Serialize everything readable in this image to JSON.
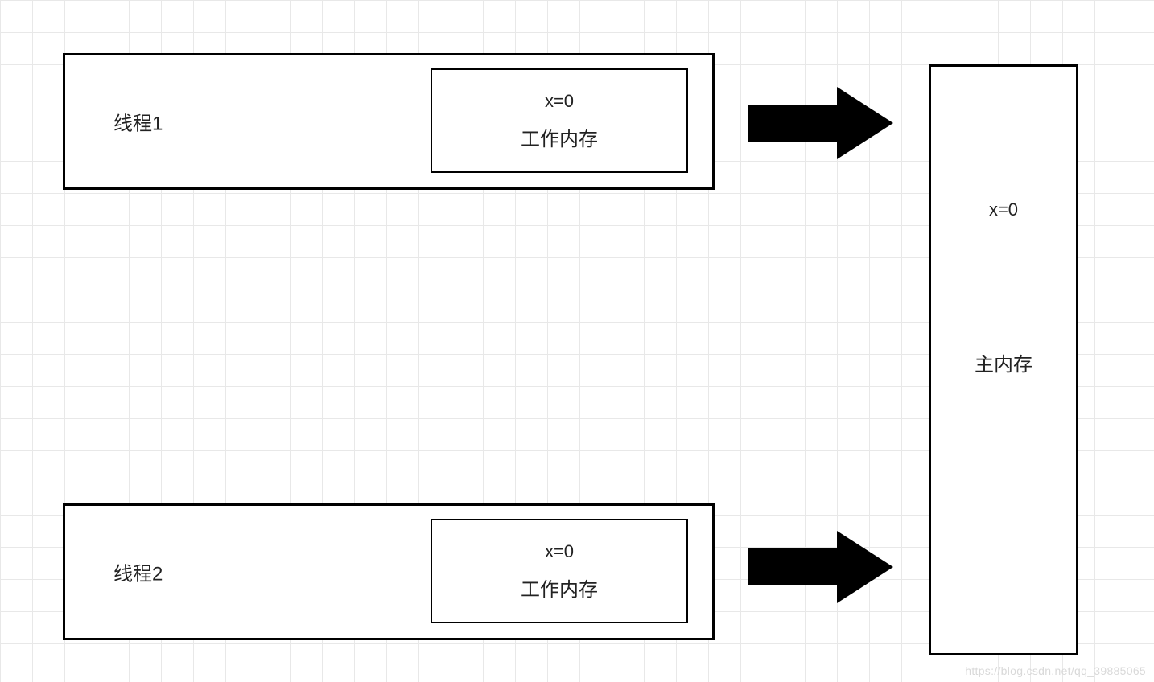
{
  "threads": [
    {
      "label": "线程1",
      "working_memory": {
        "variable": "x=0",
        "label": "工作内存"
      }
    },
    {
      "label": "线程2",
      "working_memory": {
        "variable": "x=0",
        "label": "工作内存"
      }
    }
  ],
  "main_memory": {
    "variable": "x=0",
    "label": "主内存"
  },
  "watermark": "https://blog.csdn.net/qq_39885065"
}
